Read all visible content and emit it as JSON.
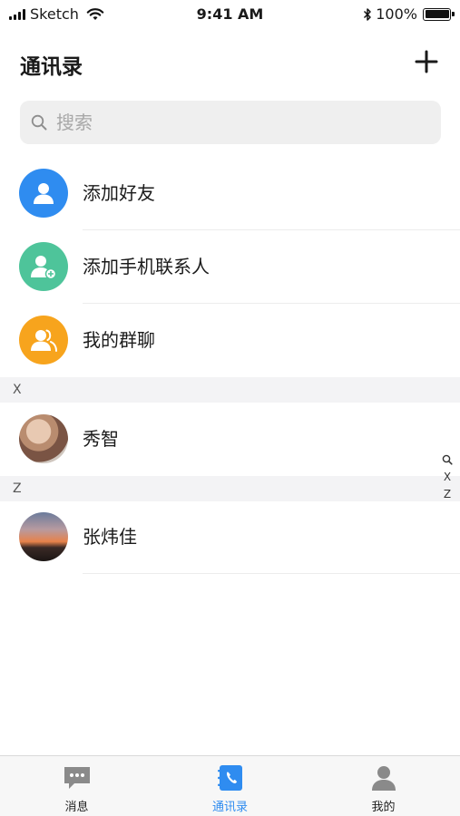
{
  "status_bar": {
    "carrier": "Sketch",
    "time": "9:41 AM",
    "battery": "100%"
  },
  "header": {
    "title": "通讯录",
    "add_icon": "plus-icon"
  },
  "search": {
    "placeholder": "搜索",
    "icon": "search-icon"
  },
  "quick_actions": [
    {
      "label": "添加好友",
      "icon": "person-icon",
      "color": "#2f8cf0"
    },
    {
      "label": "添加手机联系人",
      "icon": "person-add-icon",
      "color": "#4ec49a"
    },
    {
      "label": "我的群聊",
      "icon": "group-icon",
      "color": "#f7a41d"
    }
  ],
  "sections": [
    {
      "letter": "X",
      "contacts": [
        {
          "name": "秀智"
        }
      ]
    },
    {
      "letter": "Z",
      "contacts": [
        {
          "name": "张炜佳"
        }
      ]
    }
  ],
  "index_bar": [
    "X",
    "Z"
  ],
  "tabs": [
    {
      "label": "消息",
      "icon": "chat-icon",
      "active": false
    },
    {
      "label": "通讯录",
      "icon": "contacts-book-icon",
      "active": true
    },
    {
      "label": "我的",
      "icon": "profile-icon",
      "active": false
    }
  ],
  "colors": {
    "accent": "#2f8cf0",
    "tab_inactive": "#8a8a8a"
  }
}
